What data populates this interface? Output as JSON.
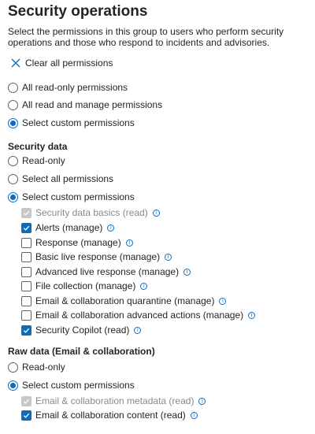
{
  "title": "Security operations",
  "description": "Select the permissions in this group to users who perform security operations and those who respond to incidents and advisories.",
  "clear_all_label": "Clear all permissions",
  "top_options": [
    {
      "label": "All read-only permissions",
      "selected": false
    },
    {
      "label": "All read and manage permissions",
      "selected": false
    },
    {
      "label": "Select custom permissions",
      "selected": true
    }
  ],
  "security_data": {
    "heading": "Security data",
    "options": [
      {
        "label": "Read-only",
        "selected": false
      },
      {
        "label": "Select all permissions",
        "selected": false
      },
      {
        "label": "Select custom permissions",
        "selected": true
      }
    ],
    "permissions": [
      {
        "label": "Security data basics (read)",
        "state": "disabled-checked"
      },
      {
        "label": "Alerts (manage)",
        "state": "checked"
      },
      {
        "label": "Response (manage)",
        "state": "unchecked"
      },
      {
        "label": "Basic live response (manage)",
        "state": "unchecked"
      },
      {
        "label": "Advanced live response (manage)",
        "state": "unchecked"
      },
      {
        "label": "File collection (manage)",
        "state": "unchecked"
      },
      {
        "label": "Email & collaboration quarantine (manage)",
        "state": "unchecked"
      },
      {
        "label": "Email & collaboration advanced actions (manage)",
        "state": "unchecked"
      },
      {
        "label": "Security Copilot (read)",
        "state": "checked"
      }
    ]
  },
  "raw_data": {
    "heading": "Raw data (Email & collaboration)",
    "options": [
      {
        "label": "Read-only",
        "selected": false
      },
      {
        "label": "Select custom permissions",
        "selected": true
      }
    ],
    "permissions": [
      {
        "label": "Email & collaboration metadata (read)",
        "state": "disabled-checked"
      },
      {
        "label": "Email & collaboration content (read)",
        "state": "checked"
      }
    ]
  },
  "icons": {
    "clear": "close-icon",
    "info": "info-icon",
    "check": "checkmark-icon"
  },
  "colors": {
    "accent": "#0f6cbd",
    "disabled": "#c8c8c8"
  }
}
